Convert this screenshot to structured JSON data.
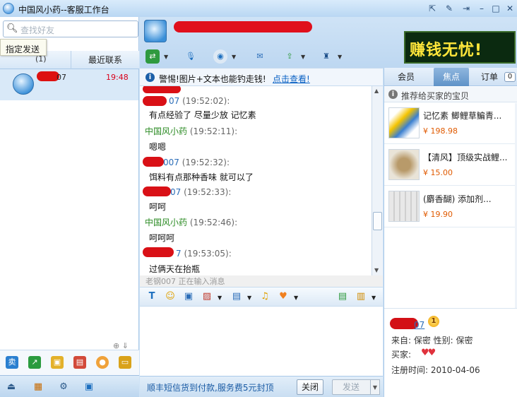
{
  "window": {
    "title": "中国风小药--客服工作台",
    "controls": [
      "⇱",
      "✎",
      "⇥",
      "–",
      "□",
      "✕"
    ]
  },
  "left": {
    "search_placeholder": "查找好友",
    "tooltip": "指定发送",
    "tab_current_label": "(1)",
    "tab_recent": "最近联系",
    "contact": {
      "name": "07",
      "time": "19:48"
    },
    "icon_labels": {
      "sell": "卖"
    }
  },
  "header": {
    "ad_text": "赚钱无忧!"
  },
  "warning": {
    "text": "警惕!图片+文本也能钓走钱!",
    "link": "点击查看!"
  },
  "chat": {
    "messages": [
      {
        "name": "07",
        "time": "(19:52:02):",
        "body": "有点经验了  尽量少放  记忆素",
        "self": false
      },
      {
        "name": "中国风小药",
        "time": "(19:52:11):",
        "body": "嗯嗯",
        "self": true
      },
      {
        "name": "007",
        "time": "(19:52:32):",
        "body": "饵料有点那种香味  就可以了",
        "self": false
      },
      {
        "name": "07",
        "time": "(19:52:33):",
        "body": "呵呵",
        "self": false
      },
      {
        "name": "中国风小药",
        "time": "(19:52:46):",
        "body": "呵呵呵",
        "self": true
      },
      {
        "name": "7",
        "time": "(19:53:05):",
        "body": "过俩天在抬瓶",
        "self": false
      }
    ],
    "typing_status": "老钢007  正在输入消息"
  },
  "bottom": {
    "notice": "顺丰短信货到付款,服务费5元封顶",
    "close_label": "关闭",
    "send_label": "发送"
  },
  "right": {
    "tabs": [
      "会员",
      "焦点",
      "订单"
    ],
    "active_tab": "焦点",
    "orders_count": "0",
    "recommend_title": "推荐给买家的宝贝",
    "products": [
      {
        "name": "记忆素  鲫鲤草鳊青...",
        "price": "¥ 198.98"
      },
      {
        "name": "【清风】顶级实战鲤...",
        "price": "¥ 15.00"
      },
      {
        "name": "(麝香醐) 添加剂...",
        "price": "¥ 19.90"
      }
    ],
    "buyer": {
      "name": "07",
      "level": "1",
      "from": "来自: 保密   性别: 保密",
      "buyer_label": "买家:",
      "hearts": "♥♥",
      "registered": "注册时间: 2010-04-06"
    }
  },
  "colors": {
    "accent": "#2b6db8",
    "self_name": "#2a8a22",
    "redaction": "#d91016",
    "price": "#e05a00"
  }
}
